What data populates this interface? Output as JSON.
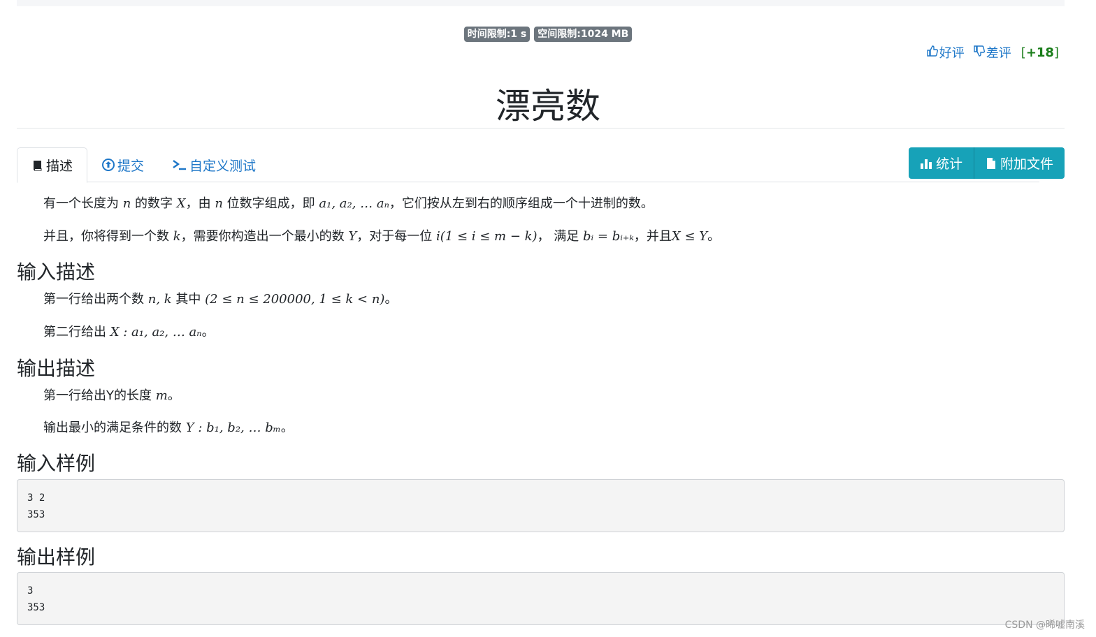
{
  "limits": {
    "time": "时间限制:1 s",
    "space": "空间限制:1024 MB"
  },
  "vote": {
    "like": "好评",
    "dislike": "差评",
    "score_open": "[",
    "score": "+18",
    "score_close": "]"
  },
  "title": "漂亮数",
  "tabs": [
    {
      "label": "描述",
      "icon": "book-icon",
      "active": true
    },
    {
      "label": "提交",
      "icon": "upload-circle-icon",
      "active": false
    },
    {
      "label": "自定义测试",
      "icon": "terminal-icon",
      "active": false
    }
  ],
  "buttons": [
    {
      "label": "统计",
      "icon": "bar-chart-icon"
    },
    {
      "label": "附加文件",
      "icon": "file-icon"
    }
  ],
  "description": {
    "p1": {
      "t1": "有一个长度为 ",
      "m1": "n",
      "t2": " 的数字 ",
      "m2": "X",
      "t3": "，由 ",
      "m3": "n",
      "t4": " 位数字组成，即 ",
      "m4": "a₁, a₂, … aₙ",
      "t5": "，它们按从左到右的顺序组成一个十进制的数。"
    },
    "p2": {
      "t1": "并且，你将得到一个数 ",
      "m1": "k",
      "t2": "，需要你构造出一个最小的数 ",
      "m2": "Y",
      "t3": "，对于每一位 ",
      "m3": "i(1 ≤ i ≤ m − k)",
      "t4": "， 满足 ",
      "m4": "bᵢ = bᵢ₊ₖ",
      "t5": "，并且",
      "m5": "X ≤ Y",
      "t6": "。"
    }
  },
  "input_section": {
    "heading": "输入描述",
    "p1": {
      "t1": "第一行给出两个数 ",
      "m1": "n, k",
      "t2": " 其中 ",
      "m2": "(2 ≤ n ≤ 200000, 1 ≤ k < n)",
      "t3": "。"
    },
    "p2": {
      "t1": "第二行给出 ",
      "m1": "X : a₁, a₂, … aₙ",
      "t2": "。"
    }
  },
  "output_section": {
    "heading": "输出描述",
    "p1": {
      "t1": "第一行给出Y的长度 ",
      "m1": "m",
      "t2": "。"
    },
    "p2": {
      "t1": "输出最小的满足条件的数 ",
      "m1": "Y : b₁, b₂, … bₘ",
      "t2": "。"
    }
  },
  "sample_input": {
    "heading": "输入样例",
    "lines": "3 2\n353"
  },
  "sample_output": {
    "heading": "输出样例",
    "lines": "3\n353"
  },
  "watermark": "CSDN @晞嘘南溪",
  "colors": {
    "link": "#1e77c8",
    "info_button": "#17a2b8",
    "badge": "#6c757d",
    "score": "#1a7d1a"
  }
}
